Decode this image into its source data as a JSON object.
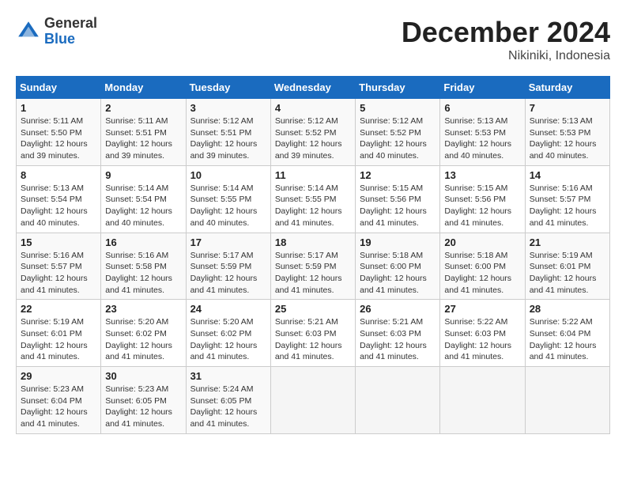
{
  "header": {
    "logo_general": "General",
    "logo_blue": "Blue",
    "month_title": "December 2024",
    "location": "Nikiniki, Indonesia"
  },
  "weekdays": [
    "Sunday",
    "Monday",
    "Tuesday",
    "Wednesday",
    "Thursday",
    "Friday",
    "Saturday"
  ],
  "weeks": [
    [
      {
        "day": "1",
        "sunrise": "5:11 AM",
        "sunset": "5:50 PM",
        "daylight": "12 hours and 39 minutes."
      },
      {
        "day": "2",
        "sunrise": "5:11 AM",
        "sunset": "5:51 PM",
        "daylight": "12 hours and 39 minutes."
      },
      {
        "day": "3",
        "sunrise": "5:12 AM",
        "sunset": "5:51 PM",
        "daylight": "12 hours and 39 minutes."
      },
      {
        "day": "4",
        "sunrise": "5:12 AM",
        "sunset": "5:52 PM",
        "daylight": "12 hours and 39 minutes."
      },
      {
        "day": "5",
        "sunrise": "5:12 AM",
        "sunset": "5:52 PM",
        "daylight": "12 hours and 40 minutes."
      },
      {
        "day": "6",
        "sunrise": "5:13 AM",
        "sunset": "5:53 PM",
        "daylight": "12 hours and 40 minutes."
      },
      {
        "day": "7",
        "sunrise": "5:13 AM",
        "sunset": "5:53 PM",
        "daylight": "12 hours and 40 minutes."
      }
    ],
    [
      {
        "day": "8",
        "sunrise": "5:13 AM",
        "sunset": "5:54 PM",
        "daylight": "12 hours and 40 minutes."
      },
      {
        "day": "9",
        "sunrise": "5:14 AM",
        "sunset": "5:54 PM",
        "daylight": "12 hours and 40 minutes."
      },
      {
        "day": "10",
        "sunrise": "5:14 AM",
        "sunset": "5:55 PM",
        "daylight": "12 hours and 40 minutes."
      },
      {
        "day": "11",
        "sunrise": "5:14 AM",
        "sunset": "5:55 PM",
        "daylight": "12 hours and 41 minutes."
      },
      {
        "day": "12",
        "sunrise": "5:15 AM",
        "sunset": "5:56 PM",
        "daylight": "12 hours and 41 minutes."
      },
      {
        "day": "13",
        "sunrise": "5:15 AM",
        "sunset": "5:56 PM",
        "daylight": "12 hours and 41 minutes."
      },
      {
        "day": "14",
        "sunrise": "5:16 AM",
        "sunset": "5:57 PM",
        "daylight": "12 hours and 41 minutes."
      }
    ],
    [
      {
        "day": "15",
        "sunrise": "5:16 AM",
        "sunset": "5:57 PM",
        "daylight": "12 hours and 41 minutes."
      },
      {
        "day": "16",
        "sunrise": "5:16 AM",
        "sunset": "5:58 PM",
        "daylight": "12 hours and 41 minutes."
      },
      {
        "day": "17",
        "sunrise": "5:17 AM",
        "sunset": "5:59 PM",
        "daylight": "12 hours and 41 minutes."
      },
      {
        "day": "18",
        "sunrise": "5:17 AM",
        "sunset": "5:59 PM",
        "daylight": "12 hours and 41 minutes."
      },
      {
        "day": "19",
        "sunrise": "5:18 AM",
        "sunset": "6:00 PM",
        "daylight": "12 hours and 41 minutes."
      },
      {
        "day": "20",
        "sunrise": "5:18 AM",
        "sunset": "6:00 PM",
        "daylight": "12 hours and 41 minutes."
      },
      {
        "day": "21",
        "sunrise": "5:19 AM",
        "sunset": "6:01 PM",
        "daylight": "12 hours and 41 minutes."
      }
    ],
    [
      {
        "day": "22",
        "sunrise": "5:19 AM",
        "sunset": "6:01 PM",
        "daylight": "12 hours and 41 minutes."
      },
      {
        "day": "23",
        "sunrise": "5:20 AM",
        "sunset": "6:02 PM",
        "daylight": "12 hours and 41 minutes."
      },
      {
        "day": "24",
        "sunrise": "5:20 AM",
        "sunset": "6:02 PM",
        "daylight": "12 hours and 41 minutes."
      },
      {
        "day": "25",
        "sunrise": "5:21 AM",
        "sunset": "6:03 PM",
        "daylight": "12 hours and 41 minutes."
      },
      {
        "day": "26",
        "sunrise": "5:21 AM",
        "sunset": "6:03 PM",
        "daylight": "12 hours and 41 minutes."
      },
      {
        "day": "27",
        "sunrise": "5:22 AM",
        "sunset": "6:03 PM",
        "daylight": "12 hours and 41 minutes."
      },
      {
        "day": "28",
        "sunrise": "5:22 AM",
        "sunset": "6:04 PM",
        "daylight": "12 hours and 41 minutes."
      }
    ],
    [
      {
        "day": "29",
        "sunrise": "5:23 AM",
        "sunset": "6:04 PM",
        "daylight": "12 hours and 41 minutes."
      },
      {
        "day": "30",
        "sunrise": "5:23 AM",
        "sunset": "6:05 PM",
        "daylight": "12 hours and 41 minutes."
      },
      {
        "day": "31",
        "sunrise": "5:24 AM",
        "sunset": "6:05 PM",
        "daylight": "12 hours and 41 minutes."
      },
      null,
      null,
      null,
      null
    ]
  ]
}
